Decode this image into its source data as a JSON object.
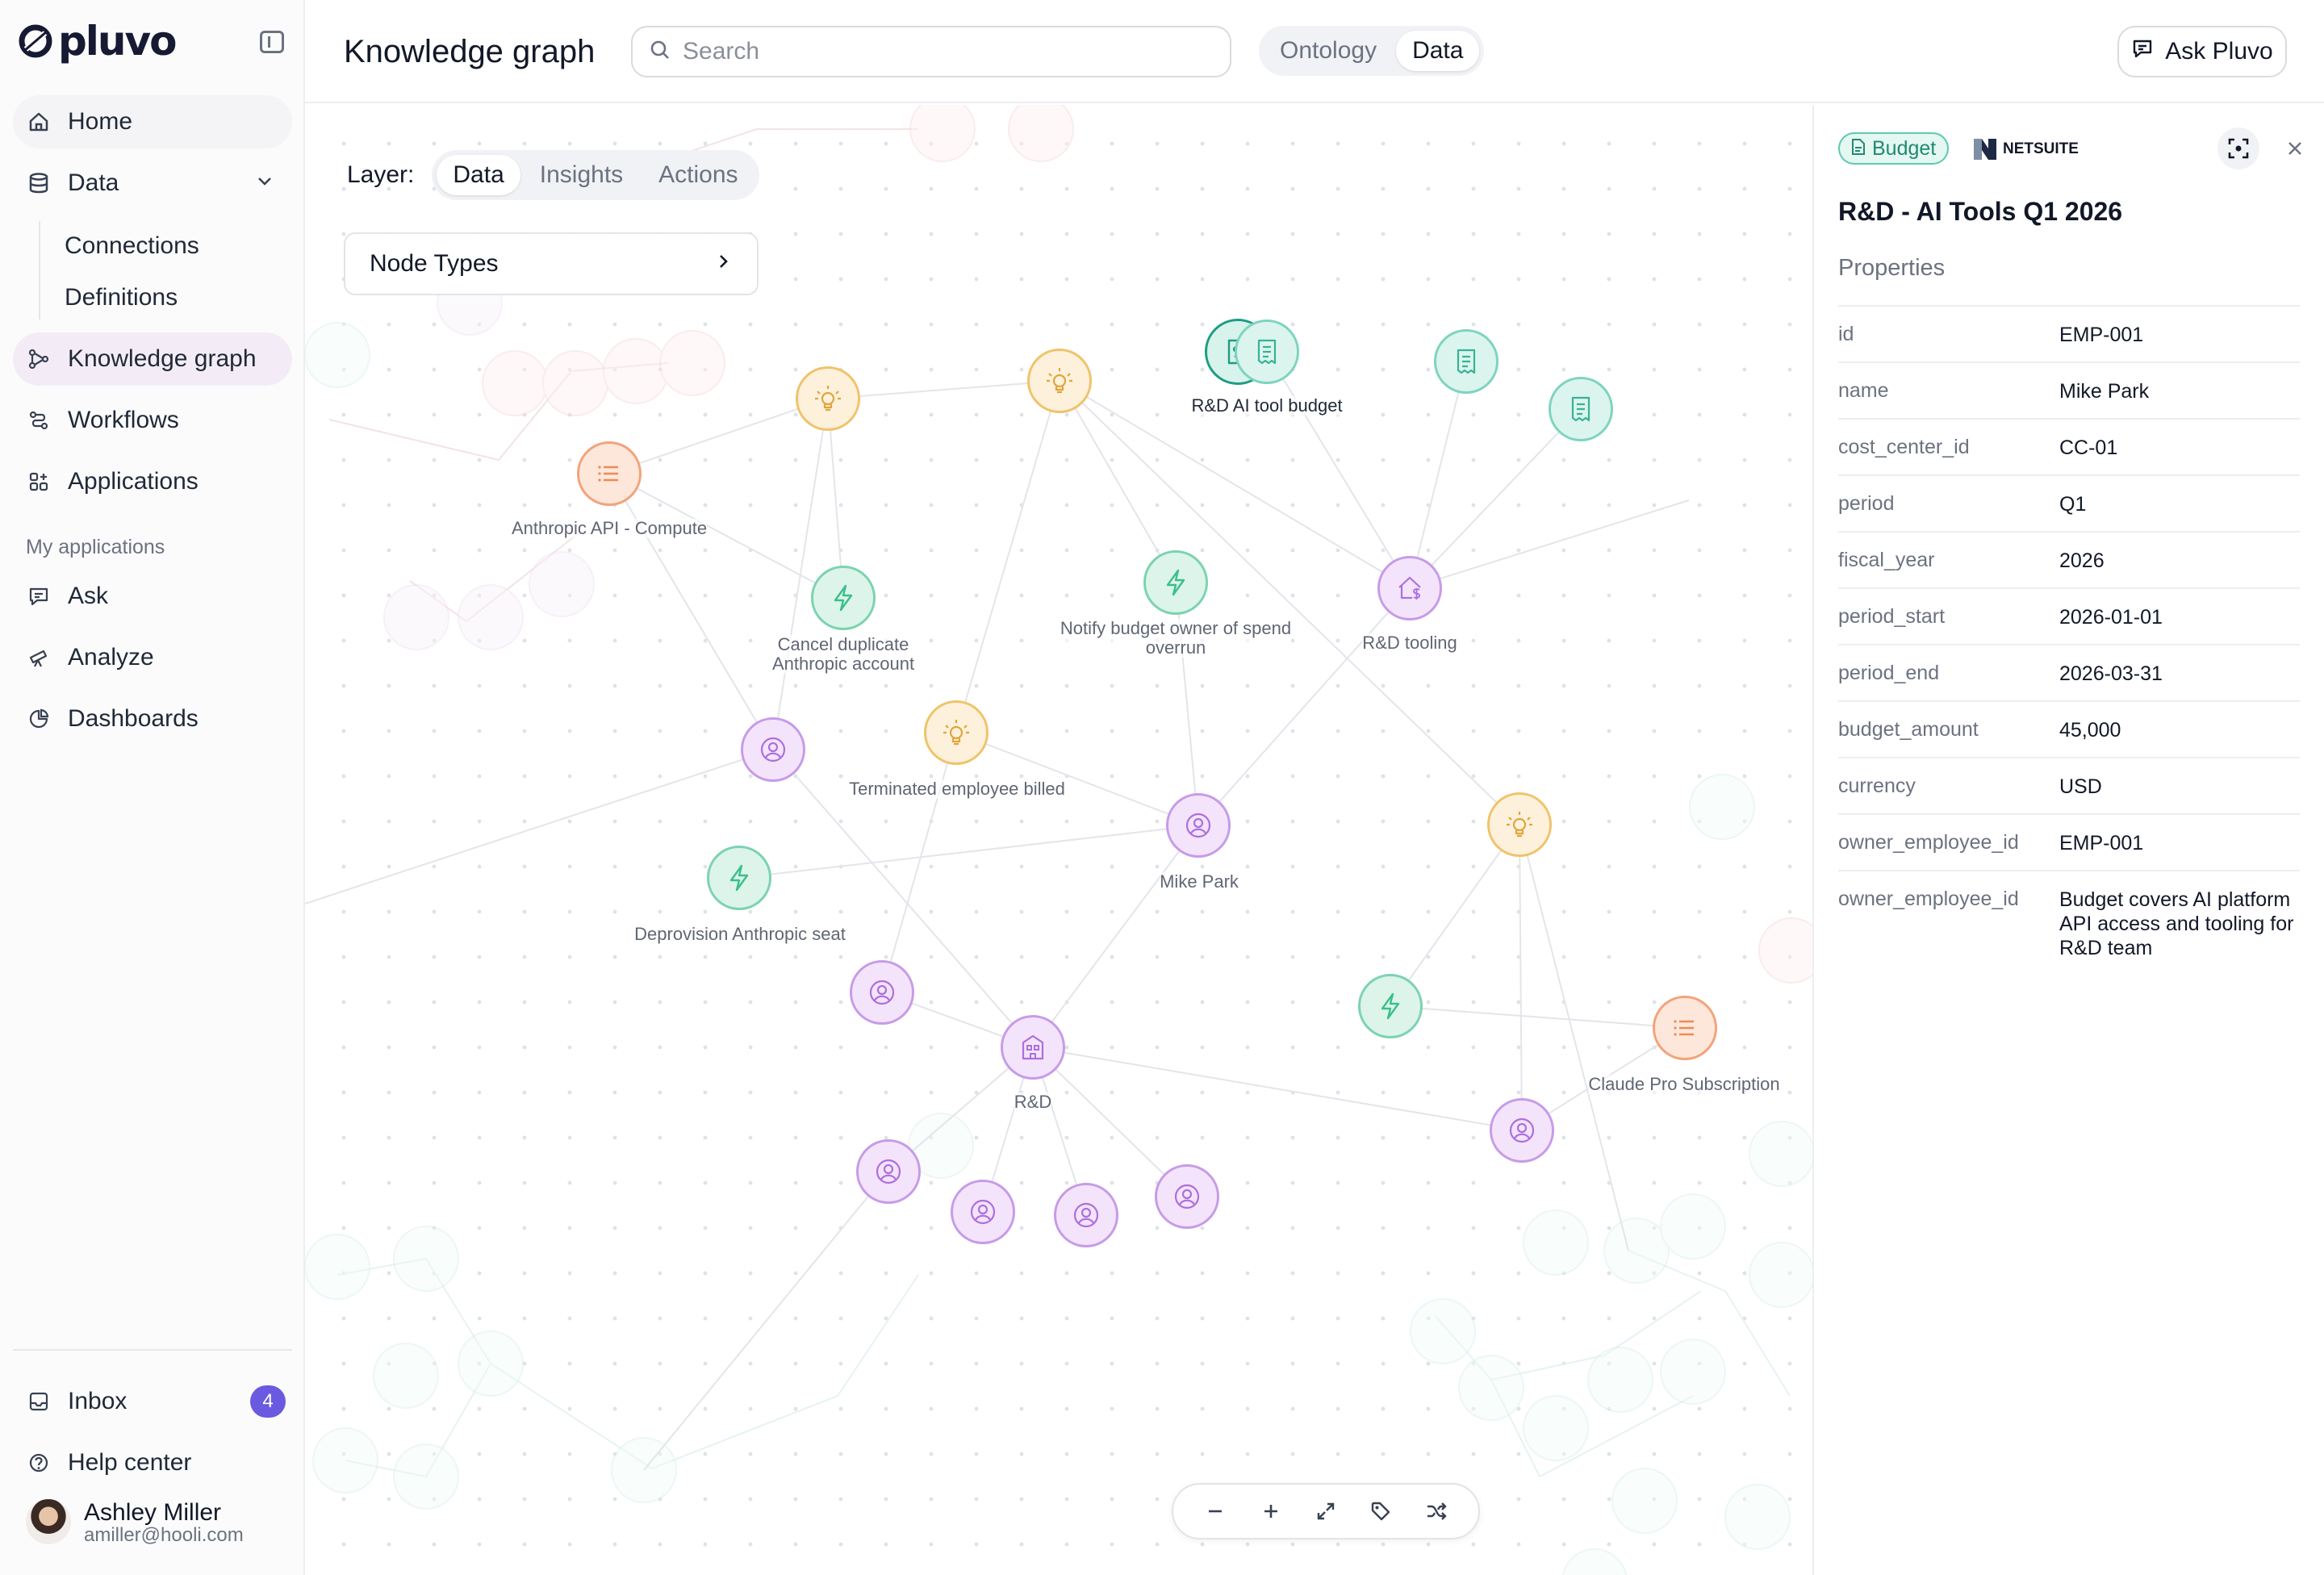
{
  "app": {
    "logo_text": "pluvo"
  },
  "sidebar": {
    "home": "Home",
    "data": "Data",
    "data_children": [
      "Connections",
      "Definitions"
    ],
    "knowledge_graph": "Knowledge graph",
    "workflows": "Workflows",
    "applications": "Applications",
    "section_label": "My applications",
    "ask": "Ask",
    "analyze": "Analyze",
    "dashboards": "Dashboards",
    "inbox": "Inbox",
    "inbox_count": "4",
    "help_center": "Help center",
    "user_name": "Ashley Miller",
    "user_email": "amiller@hooli.com"
  },
  "header": {
    "title": "Knowledge graph",
    "search_placeholder": "Search",
    "view_options": [
      "Ontology",
      "Data"
    ],
    "selected_view": "Data",
    "ask_button": "Ask Pluvo"
  },
  "canvas": {
    "layer_label": "Layer:",
    "layer_options": [
      "Data",
      "Insights",
      "Actions"
    ],
    "selected_layer": "Data",
    "node_types_label": "Node Types",
    "node_labels": {
      "rd_ai_tool_budget": "R&D AI tool budget",
      "anthropic_api": "Anthropic API - Compute",
      "cancel_duplicate": "Cancel duplicate\nAnthropic account",
      "notify_budget_owner": "Notify budget owner of spend\noverrun",
      "rd_tooling": "R&D tooling",
      "terminated_employee": "Terminated employee billed",
      "mike_park": "Mike Park",
      "deprovision": "Deprovision Anthropic seat",
      "claude_pro": "Claude Pro Subscription",
      "rd": "R&D"
    }
  },
  "panel": {
    "type_badge": "Budget",
    "source_name": "NETSUITE",
    "title": "R&D - AI Tools Q1 2026",
    "properties_heading": "Properties",
    "properties": [
      {
        "key": "id",
        "value": "EMP-001"
      },
      {
        "key": "name",
        "value": "Mike Park"
      },
      {
        "key": "cost_center_id",
        "value": "CC-01"
      },
      {
        "key": "period",
        "value": "Q1"
      },
      {
        "key": "fiscal_year",
        "value": "2026"
      },
      {
        "key": "period_start",
        "value": "2026-01-01"
      },
      {
        "key": "period_end",
        "value": "2026-03-31"
      },
      {
        "key": "budget_amount",
        "value": "45,000"
      },
      {
        "key": "currency",
        "value": "USD"
      },
      {
        "key": "owner_employee_id",
        "value": "EMP-001"
      },
      {
        "key": "owner_employee_id",
        "value": "Budget covers AI platform API access and tooling for R&D team"
      }
    ]
  },
  "colors": {
    "accent": "#6a5ae0",
    "insight": "#f0b14a",
    "action": "#3fbf8f",
    "person": "#b36fe0",
    "document": "#3ec3a5",
    "list": "#f08a4b"
  }
}
